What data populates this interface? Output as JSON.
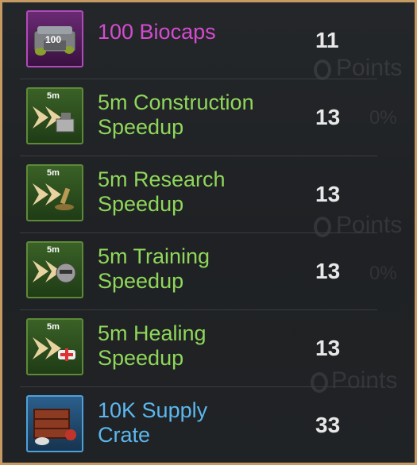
{
  "background": {
    "ghost_points": [
      "Points",
      "Points",
      "Points"
    ],
    "ghost_percent": [
      "0%",
      "0%"
    ]
  },
  "items": [
    {
      "name": "100 Biocaps",
      "qty": "11",
      "rarity": "purple",
      "icon": "biocaps-icon",
      "tag": "100"
    },
    {
      "name_line1": "5m Construction",
      "name_line2": "Speedup",
      "qty": "13",
      "rarity": "green",
      "icon": "construction-speedup-icon",
      "tag": "5m"
    },
    {
      "name_line1": "5m Research",
      "name_line2": "Speedup",
      "qty": "13",
      "rarity": "green",
      "icon": "research-speedup-icon",
      "tag": "5m"
    },
    {
      "name_line1": "5m Training",
      "name_line2": "Speedup",
      "qty": "13",
      "rarity": "green",
      "icon": "training-speedup-icon",
      "tag": "5m"
    },
    {
      "name_line1": "5m Healing",
      "name_line2": "Speedup",
      "qty": "13",
      "rarity": "green",
      "icon": "healing-speedup-icon",
      "tag": "5m"
    },
    {
      "name_line1": "10K Supply",
      "name_line2": "Crate",
      "qty": "33",
      "rarity": "blue",
      "icon": "supply-crate-icon"
    }
  ],
  "colors": {
    "border": "#c59a63",
    "purple": "#d54bd0",
    "green": "#8fd75a",
    "blue": "#5cb7ee",
    "qty": "#e8e8e8"
  }
}
